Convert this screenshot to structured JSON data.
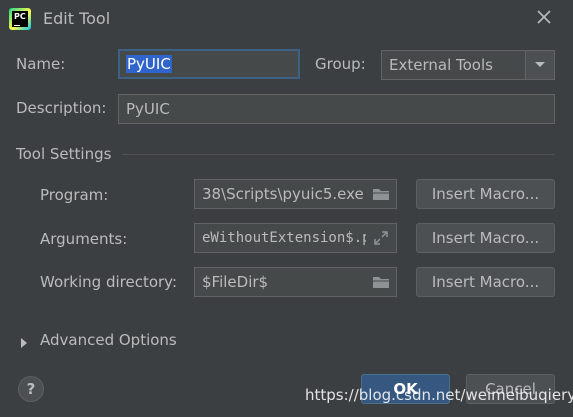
{
  "window": {
    "title": "Edit Tool"
  },
  "form": {
    "name_label": "Name:",
    "name_value": "PyUIC",
    "group_label": "Group:",
    "group_value": "External Tools",
    "description_label": "Description:",
    "description_value": "PyUIC"
  },
  "tool_settings": {
    "section_title": "Tool Settings",
    "program_label": "Program:",
    "program_value": "‌38\\Scripts\\pyuic5.exe",
    "arguments_label": "Arguments:",
    "arguments_value": "eWithoutExtension$.py",
    "working_dir_label": "Working directory:",
    "working_dir_value": "$FileDir$",
    "insert_macro_label": "Insert Macro..."
  },
  "advanced": {
    "label": "Advanced Options"
  },
  "footer": {
    "help_label": "?",
    "ok_label": "OK",
    "cancel_label": "Cancel"
  },
  "watermark": "https://blog.csdn.net/weimeibuqieryu",
  "icons": {
    "app": "pycharm-logo-icon",
    "close": "close-icon",
    "dropdown": "chevron-down-icon",
    "folder": "folder-icon",
    "expand": "expand-icon",
    "disclosure": "triangle-right-icon"
  },
  "colors": {
    "background": "#3c3f41",
    "field_bg": "#45494a",
    "focus_border": "#3d6185",
    "selection": "#2f65ca",
    "primary_button": "#365880"
  }
}
